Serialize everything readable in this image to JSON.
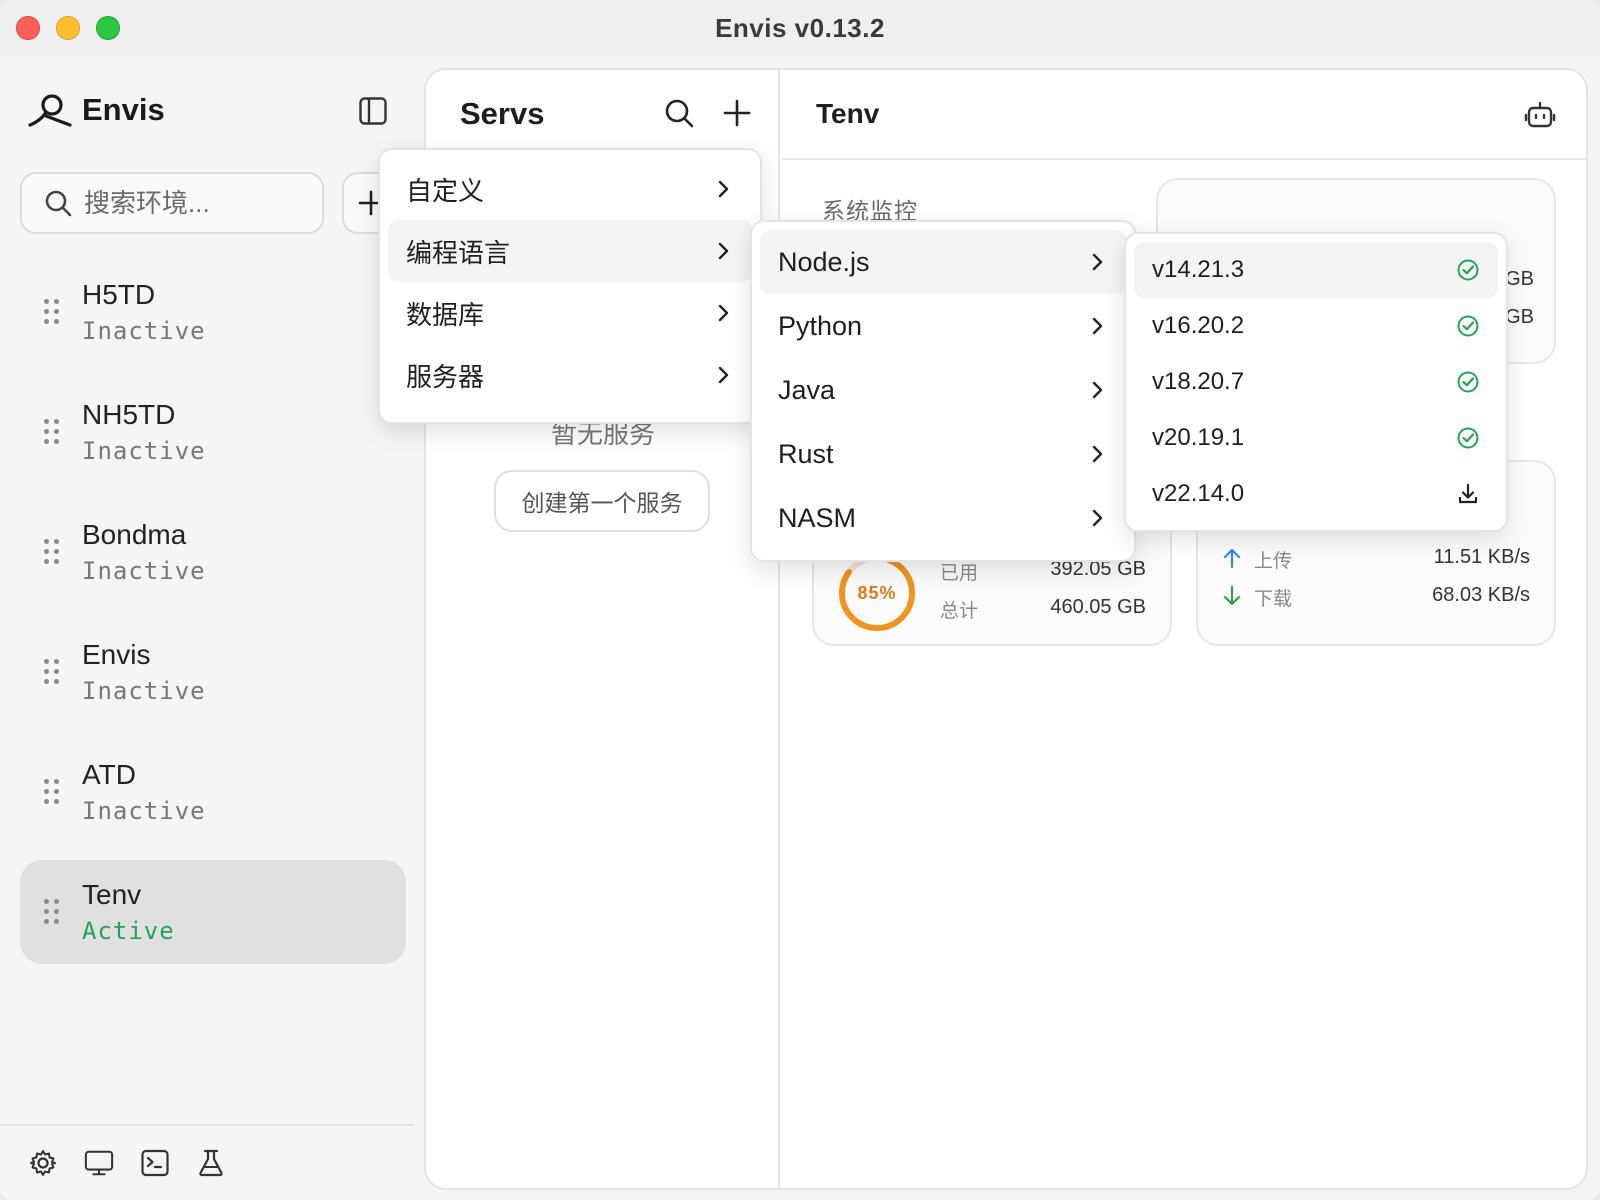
{
  "window": {
    "title": "Envis  v0.13.2"
  },
  "sidebar": {
    "brand": "Envis",
    "search_placeholder": "搜索环境...",
    "add_label": "+",
    "items": [
      {
        "name": "H5TD",
        "status": "Inactive"
      },
      {
        "name": "NH5TD",
        "status": "Inactive"
      },
      {
        "name": "Bondma",
        "status": "Inactive"
      },
      {
        "name": "Envis",
        "status": "Inactive"
      },
      {
        "name": "ATD",
        "status": "Inactive"
      },
      {
        "name": "Tenv",
        "status": "Active"
      }
    ],
    "footer_icons": [
      "gear-icon",
      "monitor-icon",
      "terminal-icon",
      "flask-icon"
    ]
  },
  "servs": {
    "title": "Servs",
    "empty_text": "暂无服务",
    "create_label": "创建第一个服务"
  },
  "tenv": {
    "title": "Tenv",
    "section_label": "系统监控",
    "memory": {
      "used_value_partial": "GB",
      "total_value_partial": "GB"
    },
    "disk": {
      "percent": "85%",
      "percent_value": 0.85,
      "used_label": "已用",
      "used_value": "392.05 GB",
      "total_label": "总计",
      "total_value": "460.05 GB"
    },
    "network": {
      "upload_label": "上传",
      "upload_value": "11.51 KB/s",
      "download_label": "下载",
      "download_value": "68.03 KB/s"
    }
  },
  "menus": {
    "categories": [
      "自定义",
      "编程语言",
      "数据库",
      "服务器"
    ],
    "languages": [
      "Node.js",
      "Python",
      "Java",
      "Rust",
      "NASM"
    ],
    "versions": [
      {
        "label": "v14.21.3",
        "state": "installed"
      },
      {
        "label": "v16.20.2",
        "state": "installed"
      },
      {
        "label": "v18.20.7",
        "state": "installed"
      },
      {
        "label": "v20.19.1",
        "state": "installed"
      },
      {
        "label": "v22.14.0",
        "state": "download"
      }
    ]
  },
  "colors": {
    "active_status": "#22a454",
    "installed_check": "#22a454",
    "disk_gauge": "#f0931f",
    "upload_arrow": "#3b82f6",
    "download_arrow": "#22a454"
  }
}
